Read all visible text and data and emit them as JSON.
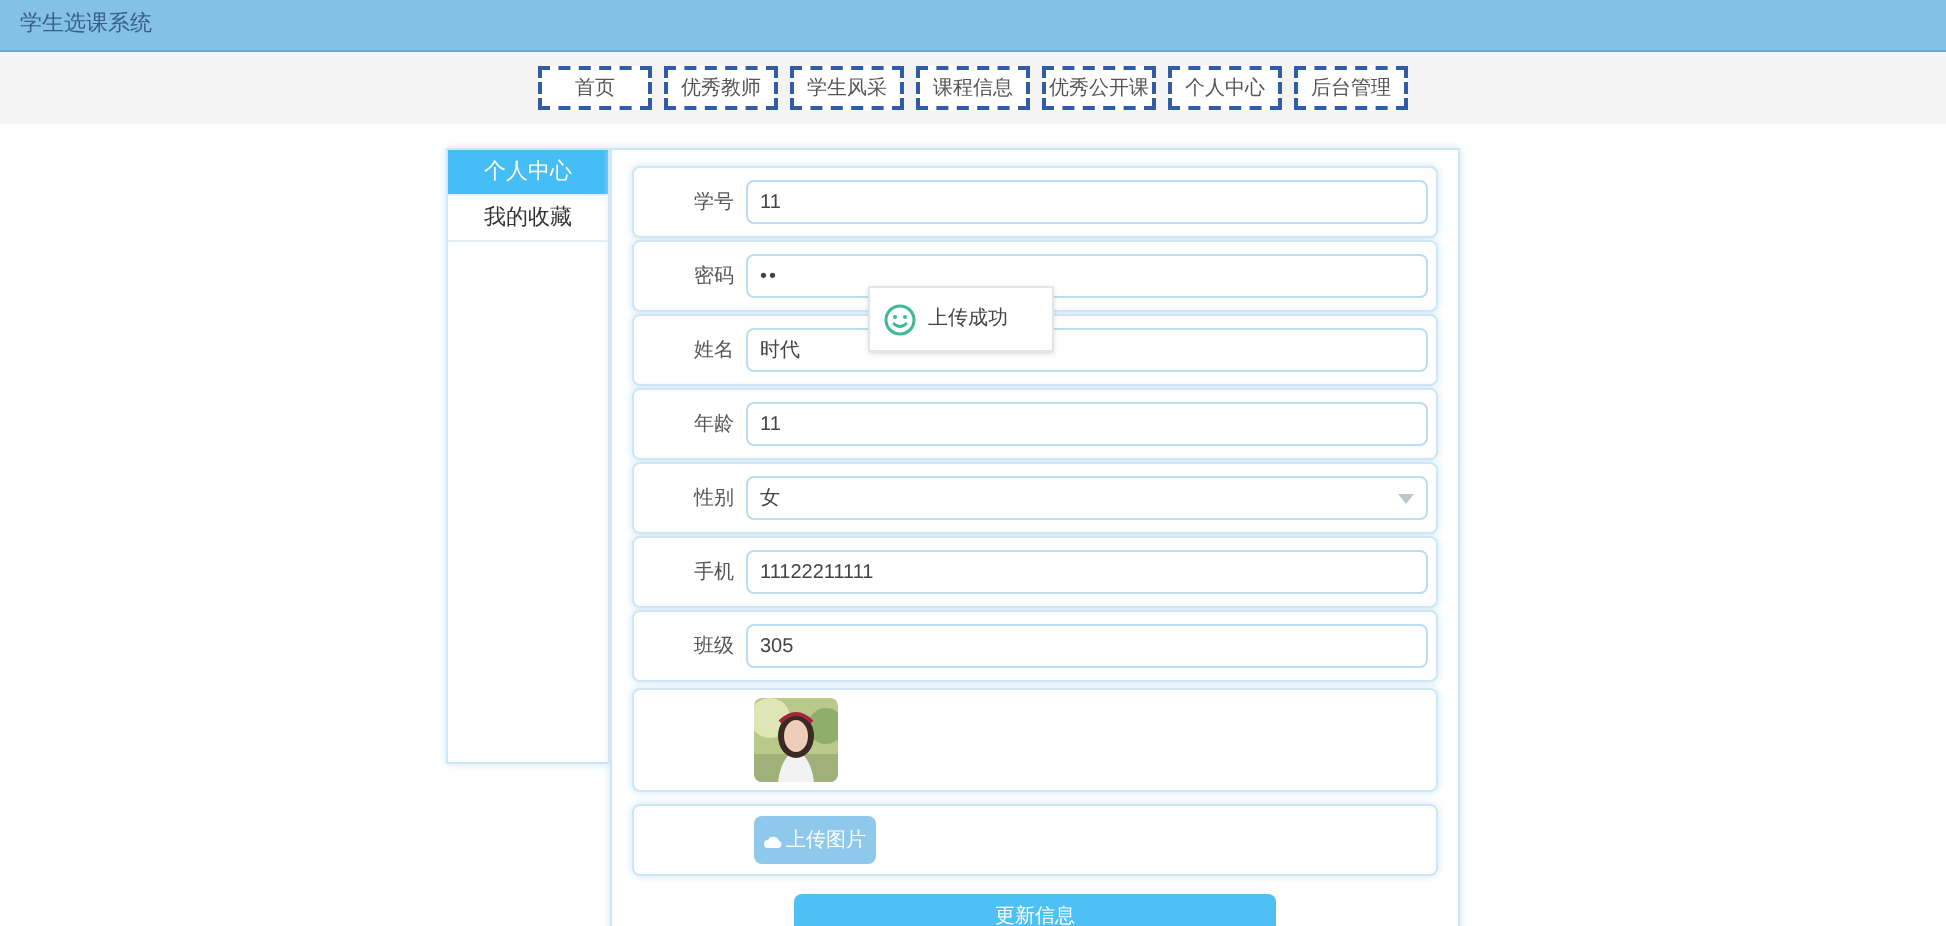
{
  "header": {
    "title": "学生选课系统"
  },
  "nav": [
    {
      "label": "首页"
    },
    {
      "label": "优秀教师"
    },
    {
      "label": "学生风采"
    },
    {
      "label": "课程信息"
    },
    {
      "label": "优秀公开课"
    },
    {
      "label": "个人中心"
    },
    {
      "label": "后台管理"
    }
  ],
  "sidebar": [
    {
      "label": "个人中心",
      "selected": true
    },
    {
      "label": "我的收藏",
      "selected": false
    }
  ],
  "form": {
    "fields": [
      {
        "kind": "text",
        "label": "学号",
        "value": "11"
      },
      {
        "kind": "password",
        "label": "密码",
        "value": "••"
      },
      {
        "kind": "text",
        "label": "姓名",
        "value": "时代"
      },
      {
        "kind": "text",
        "label": "年龄",
        "value": "11"
      },
      {
        "kind": "select",
        "label": "性别",
        "value": "女"
      },
      {
        "kind": "text",
        "label": "手机",
        "value": "11122211111"
      },
      {
        "kind": "text",
        "label": "班级",
        "value": "305"
      }
    ],
    "upload_button": "上传图片",
    "submit_button": "更新信息"
  },
  "toast": {
    "message": "上传成功"
  }
}
